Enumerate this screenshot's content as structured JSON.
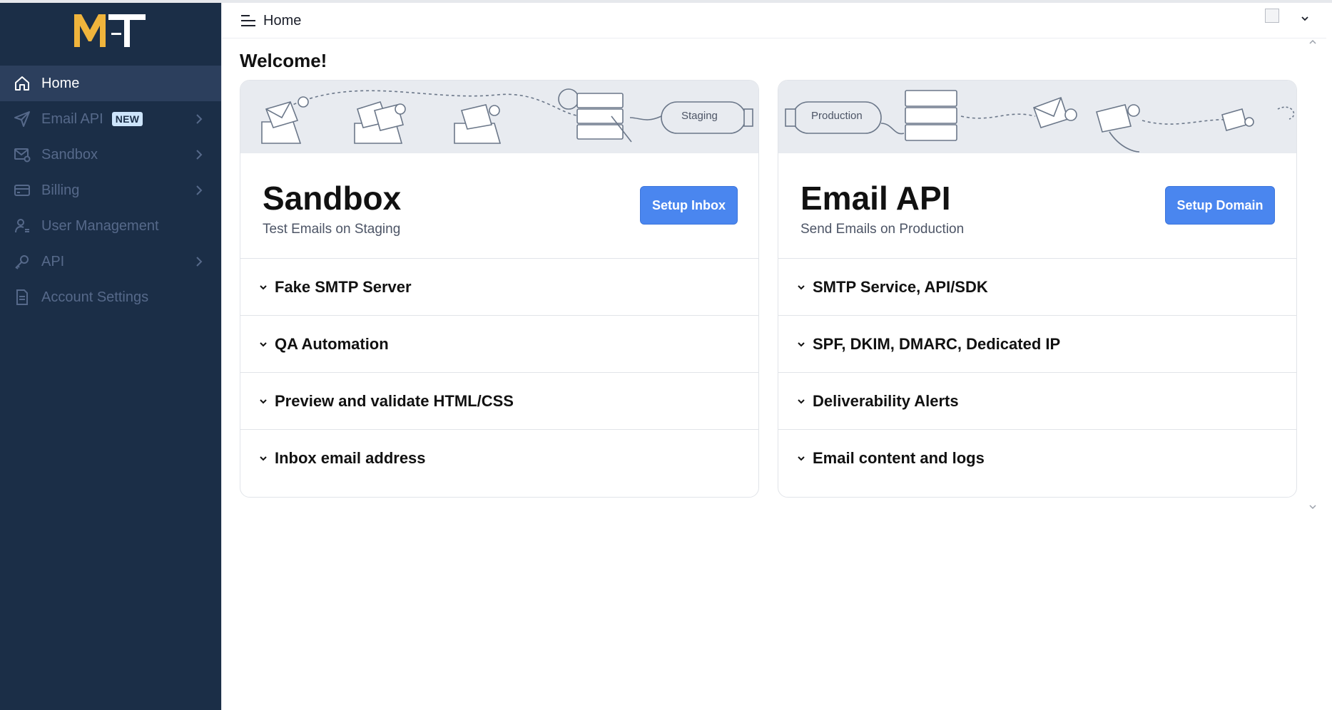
{
  "sidebar": {
    "logo_text": "MT",
    "items": [
      {
        "label": "Home",
        "icon": "home-icon",
        "active": true,
        "has_chevron": false
      },
      {
        "label": "Email API",
        "icon": "send-icon",
        "badge": "NEW",
        "has_chevron": true
      },
      {
        "label": "Sandbox",
        "icon": "mail-shield-icon",
        "has_chevron": true
      },
      {
        "label": "Billing",
        "icon": "credit-card-icon",
        "has_chevron": true
      },
      {
        "label": "User Management",
        "icon": "user-settings-icon",
        "has_chevron": false
      },
      {
        "label": "API",
        "icon": "key-icon",
        "has_chevron": true
      },
      {
        "label": "Account Settings",
        "icon": "document-icon",
        "has_chevron": false
      }
    ]
  },
  "topbar": {
    "breadcrumb": "Home"
  },
  "main": {
    "welcome": "Welcome!",
    "cards": [
      {
        "title": "Sandbox",
        "subtitle": "Test Emails on Staging",
        "button": "Setup Inbox",
        "banner_label": "Staging",
        "items": [
          "Fake SMTP Server",
          "QA Automation",
          "Preview and validate HTML/CSS",
          "Inbox email address"
        ]
      },
      {
        "title": "Email API",
        "subtitle": "Send Emails on Production",
        "button": "Setup Domain",
        "banner_label": "Production",
        "items": [
          "SMTP Service, API/SDK",
          "SPF, DKIM, DMARC, Dedicated IP",
          "Deliverability Alerts",
          "Email content and logs"
        ]
      }
    ]
  },
  "colors": {
    "sidebar_bg": "#1b2e47",
    "sidebar_active": "#2c3f5d",
    "accent_button": "#4a86ef",
    "logo_gold": "#f0b43c",
    "badge_bg": "#cde4fb"
  }
}
